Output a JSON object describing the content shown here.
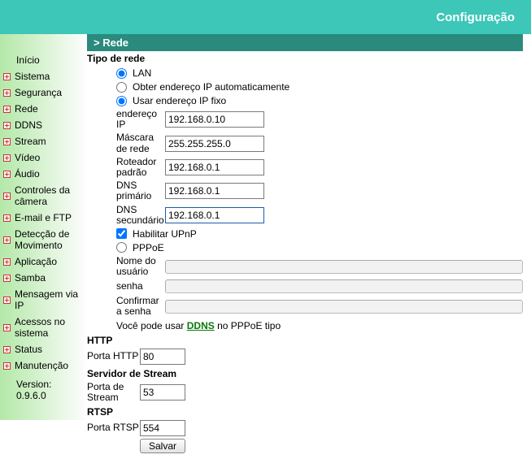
{
  "header": {
    "title": "Configuração"
  },
  "sidebar": {
    "items": [
      {
        "label": "Início",
        "expandable": false
      },
      {
        "label": "Sistema",
        "expandable": true
      },
      {
        "label": "Segurança",
        "expandable": true
      },
      {
        "label": "Rede",
        "expandable": true
      },
      {
        "label": "DDNS",
        "expandable": true
      },
      {
        "label": "Stream",
        "expandable": true
      },
      {
        "label": "Vídeo",
        "expandable": true
      },
      {
        "label": "Áudio",
        "expandable": true
      },
      {
        "label": "Controles da câmera",
        "expandable": true
      },
      {
        "label": "E-mail e FTP",
        "expandable": true
      },
      {
        "label": "Detecção de Movimento",
        "expandable": true
      },
      {
        "label": "Aplicação",
        "expandable": true
      },
      {
        "label": "Samba",
        "expandable": true
      },
      {
        "label": "Mensagem via IP",
        "expandable": true
      },
      {
        "label": "Acessos no sistema",
        "expandable": true
      },
      {
        "label": "Status",
        "expandable": true
      },
      {
        "label": "Manutenção",
        "expandable": true
      }
    ],
    "version": "Version: 0.9.6.0"
  },
  "main": {
    "section_bar": " > Rede",
    "net_type_heading": "Tipo de rede",
    "radios": {
      "lan": "LAN",
      "auto_ip": "Obter endereço IP automaticamente",
      "fixed_ip": "Usar endereço IP fixo",
      "pppoe": "PPPoE"
    },
    "ip_fields": {
      "ip_label": "endereço IP",
      "ip_value": "192.168.0.10",
      "mask_label": "Máscara de rede",
      "mask_value": "255.255.255.0",
      "gw_label": "Roteador padrão",
      "gw_value": "192.168.0.1",
      "dns1_label": "DNS primário",
      "dns1_value": "192.168.0.1",
      "dns2_label": "DNS secundário",
      "dns2_value": "192.168.0.1"
    },
    "upnp_label": "Habilitar UPnP",
    "pppoe": {
      "user_label": "Nome do usuário",
      "user_value": "",
      "pass_label": "senha",
      "pass_value": "",
      "confirm_label": "Confirmar a senha",
      "confirm_value": ""
    },
    "ddns_text_pre": "Você pode usar ",
    "ddns_link": "DDNS",
    "ddns_text_post": " no PPPoE tipo",
    "http_heading": "HTTP",
    "http_port_label": "Porta HTTP",
    "http_port_value": "80",
    "stream_heading": "Servidor de Stream",
    "stream_port_label": "Porta de Stream",
    "stream_port_value": "53",
    "rtsp_heading": "RTSP",
    "rtsp_port_label": "Porta RTSP",
    "rtsp_port_value": "554",
    "save_label": "Salvar"
  }
}
